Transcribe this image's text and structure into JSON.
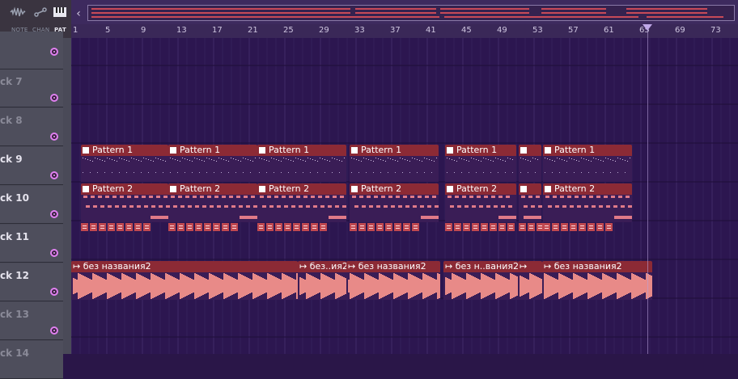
{
  "toolbar": {
    "note_label": "NOTE",
    "chan_label": "CHAN",
    "pat_label": "PAT",
    "icons": [
      "waveform-icon",
      "channel-icon",
      "piano-icon"
    ]
  },
  "ruler": {
    "ticks": [
      "1",
      "5",
      "9",
      "13",
      "17",
      "21",
      "25",
      "29",
      "33",
      "37",
      "41",
      "45",
      "49",
      "53",
      "57",
      "61",
      "65",
      "69",
      "73"
    ]
  },
  "tracks": [
    {
      "name": "ck 7",
      "muted_style": true
    },
    {
      "name": "ck 8",
      "muted_style": true
    },
    {
      "name": "ck 9",
      "muted_style": false
    },
    {
      "name": "ck 10",
      "muted_style": false
    },
    {
      "name": "ck 11",
      "muted_style": false
    },
    {
      "name": "ck 12",
      "muted_style": false
    },
    {
      "name": "ck 13",
      "muted_style": true
    },
    {
      "name": "ck 14",
      "muted_style": true
    }
  ],
  "clips": {
    "track9": [
      "Pattern 1",
      "Pattern 1",
      "Pattern 1",
      "Pattern 1",
      "Pattern 1",
      "",
      "Pattern 1"
    ],
    "track10": [
      "Pattern 2",
      "Pattern 2",
      "Pattern 2",
      "Pattern 2",
      "Pattern 2",
      "",
      "Pattern 2"
    ],
    "track12": [
      "без названия2",
      "без..ия2",
      "без названия2",
      "без н..вания2",
      "",
      "без названия2"
    ]
  },
  "colors": {
    "grid_bg": "#2c1650",
    "pattern_header": "#8c2a35",
    "audio_wave": "#e88a88",
    "header_bg": "#4e4e5c",
    "accent_dot": "#e080f0"
  }
}
